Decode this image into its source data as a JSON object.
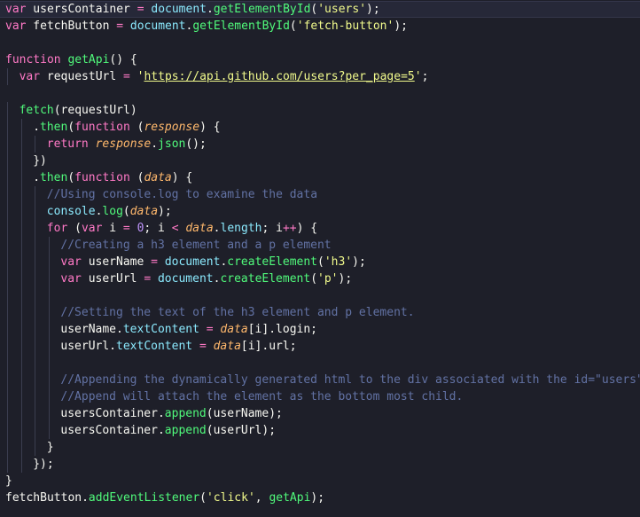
{
  "editor": {
    "language": "javascript",
    "theme_colors": {
      "background": "#1e1f29",
      "keyword": "#ff79c6",
      "function": "#50fa7b",
      "string": "#f1fa8c",
      "number": "#bd93f9",
      "parameter": "#ffb86c",
      "comment": "#6272a4",
      "builtin_object": "#8be9fd",
      "plain": "#f8f8f2"
    },
    "lines": [
      {
        "indent": 0,
        "tokens": [
          [
            "keyword",
            "var"
          ],
          [
            "plain",
            " usersContainer "
          ],
          [
            "operator",
            "="
          ],
          [
            "plain",
            " "
          ],
          [
            "object",
            "document"
          ],
          [
            "plain",
            "."
          ],
          [
            "func",
            "getElementById"
          ],
          [
            "plain",
            "("
          ],
          [
            "string",
            "'users'"
          ],
          [
            "plain",
            ");"
          ]
        ]
      },
      {
        "indent": 0,
        "tokens": [
          [
            "keyword",
            "var"
          ],
          [
            "plain",
            " fetchButton "
          ],
          [
            "operator",
            "="
          ],
          [
            "plain",
            " "
          ],
          [
            "object",
            "document"
          ],
          [
            "plain",
            "."
          ],
          [
            "func",
            "getElementById"
          ],
          [
            "plain",
            "("
          ],
          [
            "string",
            "'fetch-button'"
          ],
          [
            "plain",
            ");"
          ]
        ]
      },
      {
        "indent": 0,
        "tokens": []
      },
      {
        "indent": 0,
        "tokens": [
          [
            "keyword",
            "function"
          ],
          [
            "plain",
            " "
          ],
          [
            "func",
            "getApi"
          ],
          [
            "plain",
            "() {"
          ]
        ]
      },
      {
        "indent": 1,
        "tokens": [
          [
            "keyword",
            "var"
          ],
          [
            "plain",
            " requestUrl "
          ],
          [
            "operator",
            "="
          ],
          [
            "plain",
            " "
          ],
          [
            "string",
            "'"
          ],
          [
            "url",
            "https://api.github.com/users?per_page=5"
          ],
          [
            "string",
            "'"
          ],
          [
            "plain",
            ";"
          ]
        ]
      },
      {
        "indent": 0,
        "tokens": []
      },
      {
        "indent": 1,
        "tokens": [
          [
            "func",
            "fetch"
          ],
          [
            "plain",
            "(requestUrl)"
          ]
        ]
      },
      {
        "indent": 2,
        "tokens": [
          [
            "plain",
            "."
          ],
          [
            "func",
            "then"
          ],
          [
            "plain",
            "("
          ],
          [
            "keyword",
            "function"
          ],
          [
            "plain",
            " ("
          ],
          [
            "param",
            "response"
          ],
          [
            "plain",
            ") {"
          ]
        ]
      },
      {
        "indent": 3,
        "tokens": [
          [
            "keyword",
            "return"
          ],
          [
            "plain",
            " "
          ],
          [
            "param",
            "response"
          ],
          [
            "plain",
            "."
          ],
          [
            "func",
            "json"
          ],
          [
            "plain",
            "();"
          ]
        ]
      },
      {
        "indent": 2,
        "tokens": [
          [
            "plain",
            "})"
          ]
        ]
      },
      {
        "indent": 2,
        "tokens": [
          [
            "plain",
            "."
          ],
          [
            "func",
            "then"
          ],
          [
            "plain",
            "("
          ],
          [
            "keyword",
            "function"
          ],
          [
            "plain",
            " ("
          ],
          [
            "param",
            "data"
          ],
          [
            "plain",
            ") {"
          ]
        ]
      },
      {
        "indent": 3,
        "tokens": [
          [
            "comment",
            "//Using console.log to examine the data"
          ]
        ]
      },
      {
        "indent": 3,
        "tokens": [
          [
            "object",
            "console"
          ],
          [
            "plain",
            "."
          ],
          [
            "func",
            "log"
          ],
          [
            "plain",
            "("
          ],
          [
            "param",
            "data"
          ],
          [
            "plain",
            ");"
          ]
        ]
      },
      {
        "indent": 3,
        "tokens": [
          [
            "keyword",
            "for"
          ],
          [
            "plain",
            " ("
          ],
          [
            "keyword",
            "var"
          ],
          [
            "plain",
            " i "
          ],
          [
            "operator",
            "="
          ],
          [
            "plain",
            " "
          ],
          [
            "number",
            "0"
          ],
          [
            "plain",
            "; i "
          ],
          [
            "operator",
            "<"
          ],
          [
            "plain",
            " "
          ],
          [
            "param",
            "data"
          ],
          [
            "plain",
            "."
          ],
          [
            "object",
            "length"
          ],
          [
            "plain",
            "; i"
          ],
          [
            "operator",
            "++"
          ],
          [
            "plain",
            ") {"
          ]
        ]
      },
      {
        "indent": 4,
        "tokens": [
          [
            "comment",
            "//Creating a h3 element and a p element"
          ]
        ]
      },
      {
        "indent": 4,
        "tokens": [
          [
            "keyword",
            "var"
          ],
          [
            "plain",
            " userName "
          ],
          [
            "operator",
            "="
          ],
          [
            "plain",
            " "
          ],
          [
            "object",
            "document"
          ],
          [
            "plain",
            "."
          ],
          [
            "func",
            "createElement"
          ],
          [
            "plain",
            "("
          ],
          [
            "string",
            "'h3'"
          ],
          [
            "plain",
            ");"
          ]
        ]
      },
      {
        "indent": 4,
        "tokens": [
          [
            "keyword",
            "var"
          ],
          [
            "plain",
            " userUrl "
          ],
          [
            "operator",
            "="
          ],
          [
            "plain",
            " "
          ],
          [
            "object",
            "document"
          ],
          [
            "plain",
            "."
          ],
          [
            "func",
            "createElement"
          ],
          [
            "plain",
            "("
          ],
          [
            "string",
            "'p'"
          ],
          [
            "plain",
            ");"
          ]
        ]
      },
      {
        "indent": 4,
        "tokens": []
      },
      {
        "indent": 4,
        "tokens": [
          [
            "comment",
            "//Setting the text of the h3 element and p element."
          ]
        ]
      },
      {
        "indent": 4,
        "tokens": [
          [
            "plain",
            "userName."
          ],
          [
            "object",
            "textContent"
          ],
          [
            "plain",
            " "
          ],
          [
            "operator",
            "="
          ],
          [
            "plain",
            " "
          ],
          [
            "param",
            "data"
          ],
          [
            "plain",
            "[i].login;"
          ]
        ]
      },
      {
        "indent": 4,
        "tokens": [
          [
            "plain",
            "userUrl."
          ],
          [
            "object",
            "textContent"
          ],
          [
            "plain",
            " "
          ],
          [
            "operator",
            "="
          ],
          [
            "plain",
            " "
          ],
          [
            "param",
            "data"
          ],
          [
            "plain",
            "[i].url;"
          ]
        ]
      },
      {
        "indent": 4,
        "tokens": []
      },
      {
        "indent": 4,
        "tokens": [
          [
            "comment",
            "//Appending the dynamically generated html to the div associated with the id=\"users\""
          ]
        ]
      },
      {
        "indent": 4,
        "tokens": [
          [
            "comment",
            "//Append will attach the element as the bottom most child."
          ]
        ]
      },
      {
        "indent": 4,
        "tokens": [
          [
            "plain",
            "usersContainer."
          ],
          [
            "func",
            "append"
          ],
          [
            "plain",
            "(userName);"
          ]
        ]
      },
      {
        "indent": 4,
        "tokens": [
          [
            "plain",
            "usersContainer."
          ],
          [
            "func",
            "append"
          ],
          [
            "plain",
            "(userUrl);"
          ]
        ]
      },
      {
        "indent": 3,
        "tokens": [
          [
            "plain",
            "}"
          ]
        ]
      },
      {
        "indent": 2,
        "tokens": [
          [
            "plain",
            "});"
          ]
        ]
      },
      {
        "indent": 0,
        "tokens": [
          [
            "plain",
            "}"
          ]
        ]
      },
      {
        "indent": 0,
        "tokens": [
          [
            "plain",
            "fetchButton."
          ],
          [
            "func",
            "addEventListener"
          ],
          [
            "plain",
            "("
          ],
          [
            "string",
            "'click'"
          ],
          [
            "plain",
            ", "
          ],
          [
            "func",
            "getApi"
          ],
          [
            "plain",
            ");"
          ]
        ]
      }
    ]
  }
}
